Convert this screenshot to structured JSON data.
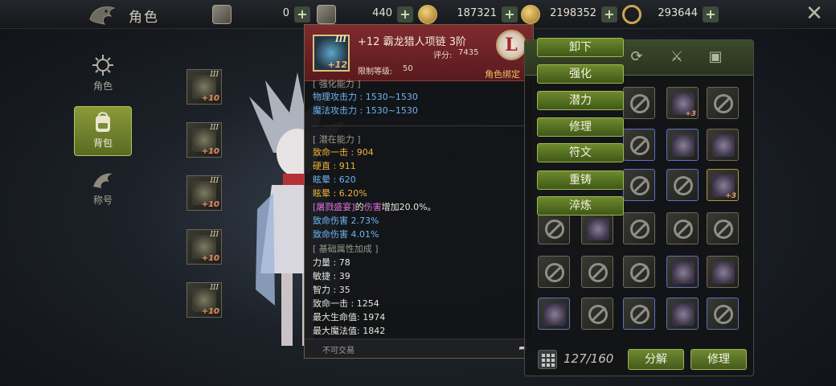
{
  "header": {
    "title": "角色",
    "currencies": [
      {
        "icon": "ticket-icon",
        "value": "0"
      },
      {
        "icon": "card-icon",
        "value": "440"
      },
      {
        "icon": "clover-coin-icon",
        "value": "187321"
      },
      {
        "icon": "gold-coin-icon",
        "value": "2198352"
      },
      {
        "icon": "ring-coin-icon",
        "value": "293644"
      }
    ],
    "plus_label": "+"
  },
  "nav": {
    "items": [
      {
        "label": "角色",
        "icon": "character-icon",
        "active": false
      },
      {
        "label": "背包",
        "icon": "backpack-icon",
        "active": true
      },
      {
        "label": "称号",
        "icon": "title-icon",
        "active": false
      }
    ]
  },
  "equipment": [
    {
      "tier": "III",
      "plus": "+10"
    },
    {
      "tier": "III",
      "plus": "+10"
    },
    {
      "tier": "III",
      "plus": "+10"
    },
    {
      "tier": "III",
      "plus": "+10"
    },
    {
      "tier": "III",
      "plus": "+10"
    }
  ],
  "tooltip": {
    "item_name": "+12 霸龙猎人项链 3阶",
    "icon_tier": "III",
    "icon_plus": "+12",
    "score_label": "评分:",
    "score": "7435",
    "req_label": "限制等级:",
    "req_level": "50",
    "rank": "L",
    "bind": "角色绑定",
    "base_section": "[ 强化能力 ]",
    "phys_attack": "物理攻击力 : 1530~1530",
    "mag_attack": "魔法攻击力 : 1530~1530",
    "potential_section": "[ 潜在能力 ]",
    "pot_1": "致命一击 : 904",
    "pot_2": "硬直 : 911",
    "pot_3": "眩晕 : 620",
    "pot_4": "眩晕 : 6.20%",
    "pot_5_skill": "[屠戮盛宴]",
    "pot_5_mid": "的",
    "pot_5_hl": "伤害",
    "pot_5_end": "增加20.0%。",
    "pot_6": "致命伤害 2.73%",
    "pot_7": "致命伤害 4.01%",
    "attr_section": "[ 基础属性加成 ]",
    "attrs": [
      "力量 : 78",
      "敏捷 : 39",
      "智力 : 35",
      "致命一击 : 1254",
      "最大生命值:  1974",
      "最大魔法值:  1842"
    ],
    "footer": "不可交易"
  },
  "context_menu": [
    "卸下",
    "强化",
    "潜力",
    "修理",
    "符文",
    "重铸",
    "淬炼"
  ],
  "inventory": {
    "count": "127/160",
    "decompose_label": "分解",
    "repair_label": "修理",
    "tab_icons": [
      "refresh-icon",
      "sword-icon",
      "chest-icon"
    ]
  },
  "colors": {
    "menu_green": "#6e8a2e",
    "tooltip_red": "#7f2a2e",
    "stat_blue": "#6fb4f0",
    "stat_orange": "#f0b23c"
  }
}
